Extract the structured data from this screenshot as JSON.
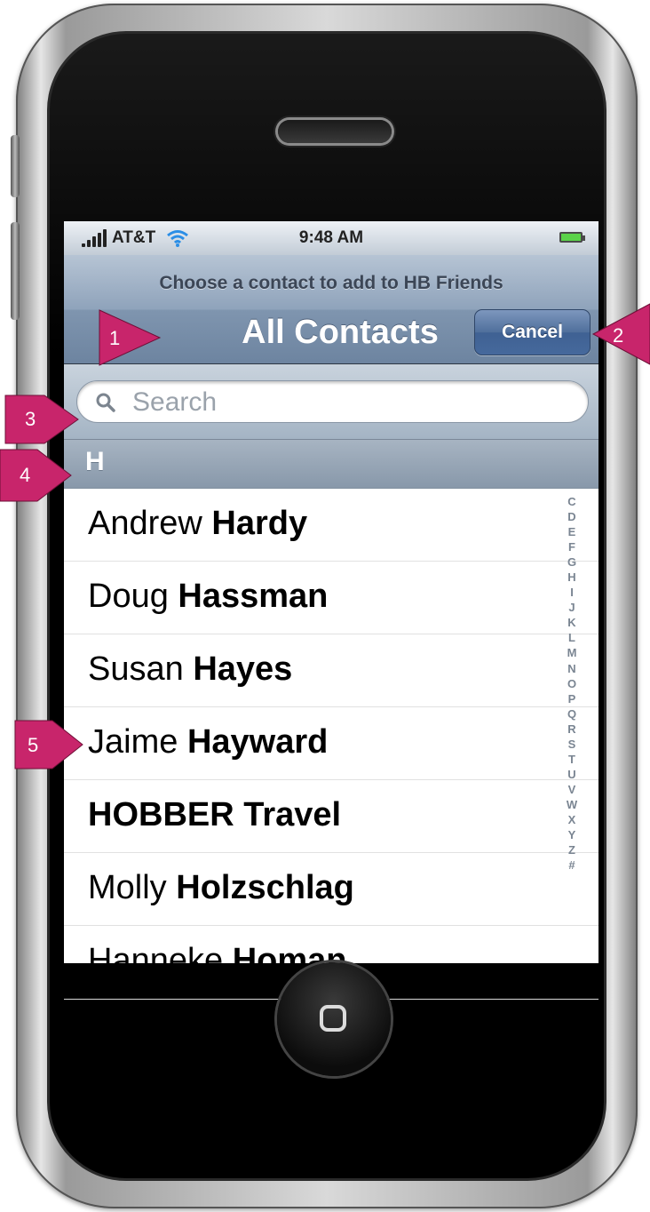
{
  "status_bar": {
    "carrier": "AT&T",
    "time": "9:48 AM"
  },
  "nav": {
    "prompt": "Choose a contact to add to HB Friends",
    "title": "All Contacts",
    "cancel_label": "Cancel"
  },
  "search": {
    "placeholder": "Search"
  },
  "section": {
    "label": "H"
  },
  "contacts": [
    {
      "first": "Andrew",
      "last": "Hardy"
    },
    {
      "first": "Doug",
      "last": "Hassman"
    },
    {
      "first": "Susan",
      "last": "Hayes"
    },
    {
      "first": "Jaime",
      "last": "Hayward"
    },
    {
      "first": "",
      "last": "HOBBER Travel"
    },
    {
      "first": "Molly",
      "last": "Holzschlag"
    },
    {
      "first": "Hanneke",
      "last": "Homan"
    }
  ],
  "index_letters": [
    "C",
    "D",
    "E",
    "F",
    "G",
    "H",
    "I",
    "J",
    "K",
    "L",
    "M",
    "N",
    "O",
    "P",
    "Q",
    "R",
    "S",
    "T",
    "U",
    "V",
    "W",
    "X",
    "Y",
    "Z",
    "#"
  ],
  "callouts": [
    "1",
    "2",
    "3",
    "4",
    "5"
  ],
  "colors": {
    "callout": "#c8256b",
    "cancel_button": "#46699c",
    "navbar": "#7f95af",
    "battery": "#5bd34a"
  }
}
